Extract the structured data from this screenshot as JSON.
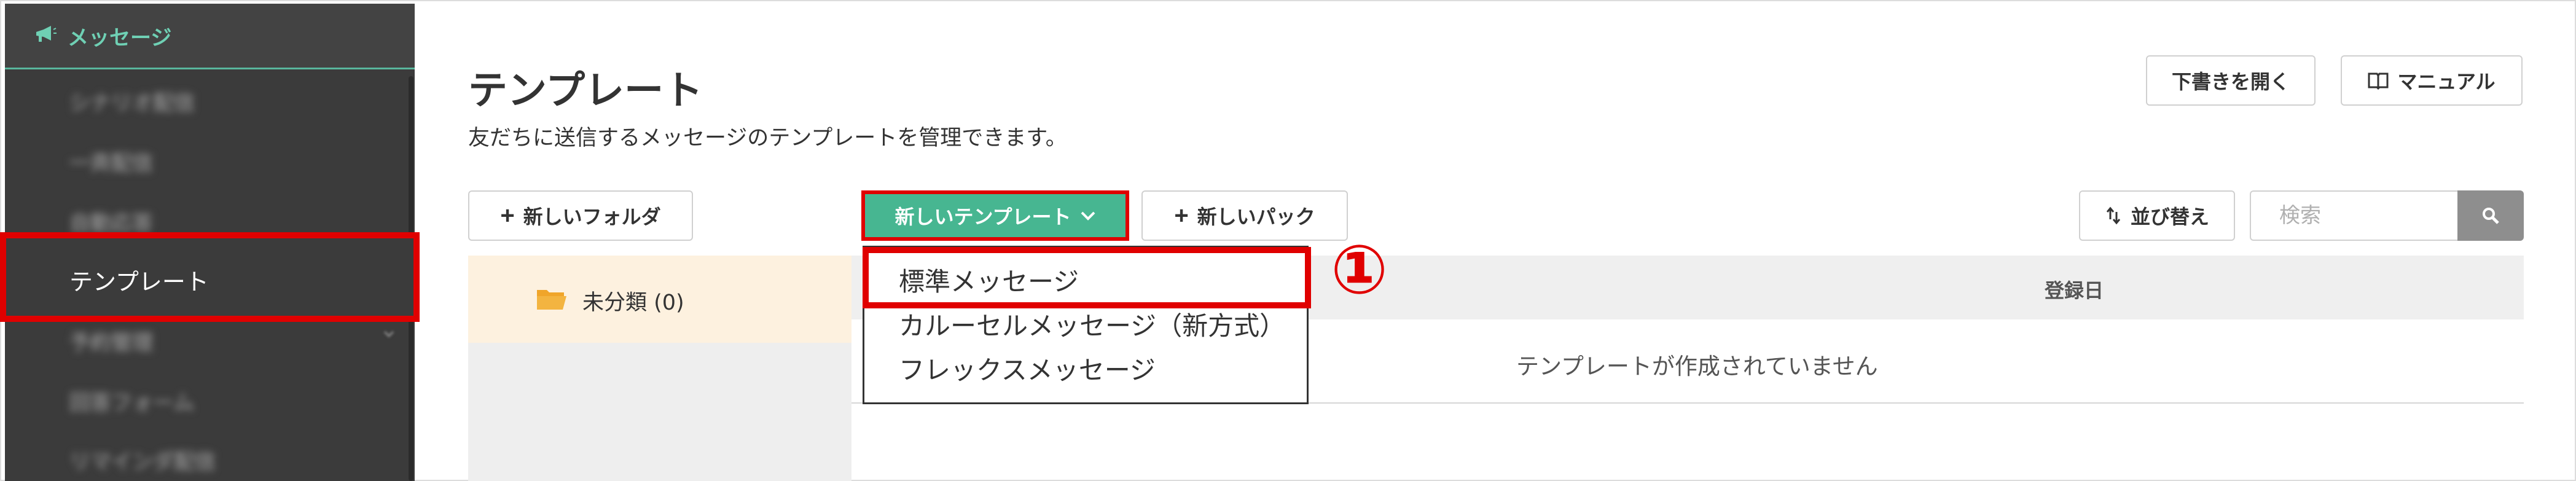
{
  "sidebar": {
    "header_title": "メッセージ",
    "items": [
      {
        "label": "シナリオ配信"
      },
      {
        "label": "一斉配信"
      },
      {
        "label": "自動応答"
      },
      {
        "label": "テンプレート"
      },
      {
        "label": "予約管理"
      },
      {
        "label": "回答フォーム"
      },
      {
        "label": "リマインダ配信"
      }
    ]
  },
  "header": {
    "title": "テンプレート",
    "description": "友だちに送信するメッセージのテンプレートを管理できます。",
    "draft_button": "下書きを開く",
    "manual_button": "マニュアル"
  },
  "toolbar": {
    "new_folder": "新しいフォルダ",
    "new_template": "新しいテンプレート",
    "new_pack": "新しいパック",
    "sort": "並び替え",
    "search_placeholder": "検索"
  },
  "folders": [
    {
      "label": "未分類 (0)"
    }
  ],
  "table": {
    "date_column": "登録日",
    "empty_message": "テンプレートが作成されていません"
  },
  "dropdown": {
    "items": [
      "標準メッセージ",
      "カルーセルメッセージ（新方式）",
      "フレックスメッセージ"
    ]
  },
  "annotation": {
    "callout": "①"
  },
  "colors": {
    "accent_green": "#47b691",
    "highlight_red": "#e00000",
    "sidebar_bg": "#3b3b3b",
    "folder_bg": "#fdf1df"
  }
}
